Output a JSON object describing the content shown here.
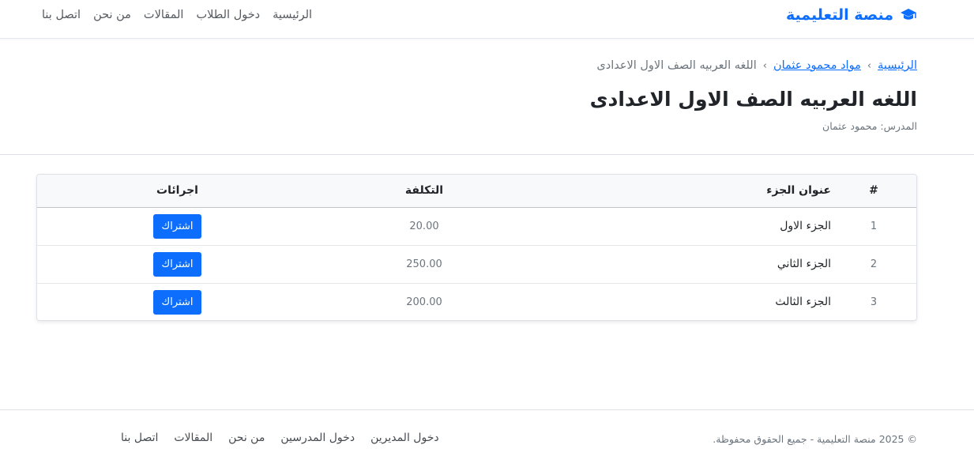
{
  "navbar": {
    "brand": "منصة التعليمية",
    "brand_icon": "graduation-cap-icon",
    "links": [
      "الرئيسية",
      "دخول الطلاب",
      "المقالات",
      "من نحن",
      "اتصل بنا"
    ]
  },
  "breadcrumb": {
    "home": "الرئيسية",
    "teacher_subjects": "مواد محمود عثمان",
    "current": "اللغه العربيه الصف الاول الاعدادى",
    "separator": "›"
  },
  "page": {
    "title": "اللغه العربيه الصف الاول الاعدادى",
    "teacher_line": "المدرس: محمود عثمان"
  },
  "table": {
    "headers": {
      "num": "#",
      "title": "عنوان الجزء",
      "cost": "التكلفة",
      "actions": "اجرائات"
    },
    "rows": [
      {
        "num": "1",
        "title": "الجزء الاول",
        "cost": "20.00",
        "action": "اشتراك"
      },
      {
        "num": "2",
        "title": "الجزء الثاني",
        "cost": "250.00",
        "action": "اشتراك"
      },
      {
        "num": "3",
        "title": "الجزء الثالث",
        "cost": "200.00",
        "action": "اشتراك"
      }
    ]
  },
  "footer": {
    "copyright": "© 2025 منصة التعليمية - جميع الحقوق محفوظة.",
    "links": [
      "دخول المديرين",
      "دخول المدرسين",
      "من نحن",
      "المقالات",
      "اتصل بنا"
    ]
  },
  "colors": {
    "accent": "#0d6efd",
    "muted": "#6c757d",
    "text": "#212529"
  }
}
